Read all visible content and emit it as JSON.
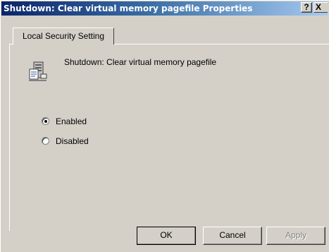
{
  "window": {
    "title": "Shutdown: Clear virtual memory pagefile Properties",
    "help_label": "?",
    "close_label": "X"
  },
  "tabs": [
    {
      "label": "Local Security Setting",
      "selected": true
    }
  ],
  "policy": {
    "icon": "policy-server-icon",
    "name": "Shutdown: Clear virtual memory pagefile"
  },
  "options": [
    {
      "label": "Enabled",
      "selected": true
    },
    {
      "label": "Disabled",
      "selected": false
    }
  ],
  "buttons": {
    "ok": "OK",
    "cancel": "Cancel",
    "apply": "Apply"
  },
  "colors": {
    "titlebar_start": "#0a246a",
    "titlebar_end": "#a6caf0",
    "face": "#d4d0c8"
  }
}
